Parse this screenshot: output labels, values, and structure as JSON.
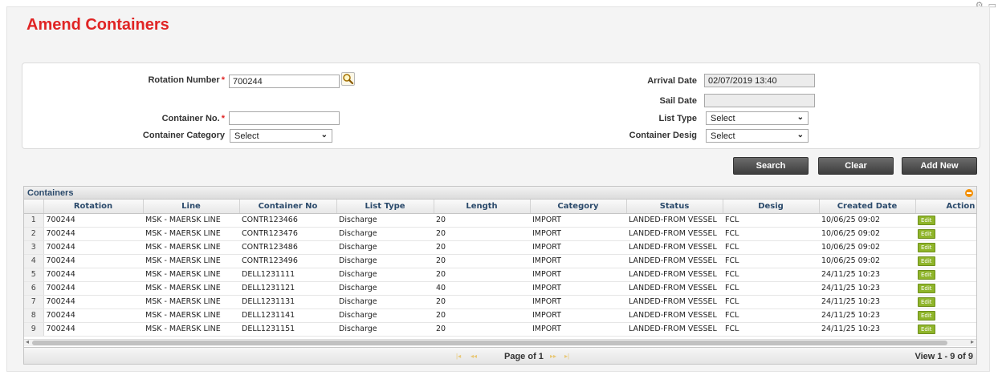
{
  "page": {
    "title": "Amend Containers"
  },
  "form": {
    "rotation_number": {
      "label": "Rotation Number",
      "required": "*",
      "value": "700244"
    },
    "container_no": {
      "label": "Container No.",
      "required": "*",
      "value": ""
    },
    "container_category": {
      "label": "Container Category",
      "value": "Select"
    },
    "arrival_date": {
      "label": "Arrival Date",
      "value": "02/07/2019 13:40"
    },
    "sail_date": {
      "label": "Sail Date",
      "value": ""
    },
    "list_type": {
      "label": "List Type",
      "value": "Select"
    },
    "container_desig": {
      "label": "Container Desig",
      "value": "Select"
    }
  },
  "buttons": {
    "search": "Search",
    "clear": "Clear",
    "add_new": "Add New"
  },
  "grid": {
    "caption": "Containers",
    "columns": [
      "Rotation",
      "Line",
      "Container No",
      "List Type",
      "Length",
      "Category",
      "Status",
      "Desig",
      "Created Date",
      "Action"
    ],
    "edit_label": "Edit",
    "rows": [
      {
        "n": "1",
        "rotation": "700244",
        "line": "MSK - MAERSK LINE",
        "container_no": "CONTR123466",
        "list_type": "Discharge",
        "length": "20",
        "category": "IMPORT",
        "status": "LANDED-FROM VESSEL",
        "desig": "FCL",
        "created": "10/06/25 09:02"
      },
      {
        "n": "2",
        "rotation": "700244",
        "line": "MSK - MAERSK LINE",
        "container_no": "CONTR123476",
        "list_type": "Discharge",
        "length": "20",
        "category": "IMPORT",
        "status": "LANDED-FROM VESSEL",
        "desig": "FCL",
        "created": "10/06/25 09:02"
      },
      {
        "n": "3",
        "rotation": "700244",
        "line": "MSK - MAERSK LINE",
        "container_no": "CONTR123486",
        "list_type": "Discharge",
        "length": "20",
        "category": "IMPORT",
        "status": "LANDED-FROM VESSEL",
        "desig": "FCL",
        "created": "10/06/25 09:02"
      },
      {
        "n": "4",
        "rotation": "700244",
        "line": "MSK - MAERSK LINE",
        "container_no": "CONTR123496",
        "list_type": "Discharge",
        "length": "20",
        "category": "IMPORT",
        "status": "LANDED-FROM VESSEL",
        "desig": "FCL",
        "created": "10/06/25 09:02"
      },
      {
        "n": "5",
        "rotation": "700244",
        "line": "MSK - MAERSK LINE",
        "container_no": "DELL1231111",
        "list_type": "Discharge",
        "length": "20",
        "category": "IMPORT",
        "status": "LANDED-FROM VESSEL",
        "desig": "FCL",
        "created": "24/11/25 10:23"
      },
      {
        "n": "6",
        "rotation": "700244",
        "line": "MSK - MAERSK LINE",
        "container_no": "DELL1231121",
        "list_type": "Discharge",
        "length": "40",
        "category": "IMPORT",
        "status": "LANDED-FROM VESSEL",
        "desig": "FCL",
        "created": "24/11/25 10:23"
      },
      {
        "n": "7",
        "rotation": "700244",
        "line": "MSK - MAERSK LINE",
        "container_no": "DELL1231131",
        "list_type": "Discharge",
        "length": "20",
        "category": "IMPORT",
        "status": "LANDED-FROM VESSEL",
        "desig": "FCL",
        "created": "24/11/25 10:23"
      },
      {
        "n": "8",
        "rotation": "700244",
        "line": "MSK - MAERSK LINE",
        "container_no": "DELL1231141",
        "list_type": "Discharge",
        "length": "20",
        "category": "IMPORT",
        "status": "LANDED-FROM VESSEL",
        "desig": "FCL",
        "created": "24/11/25 10:23"
      },
      {
        "n": "9",
        "rotation": "700244",
        "line": "MSK - MAERSK LINE",
        "container_no": "DELL1231151",
        "list_type": "Discharge",
        "length": "20",
        "category": "IMPORT",
        "status": "LANDED-FROM VESSEL",
        "desig": "FCL",
        "created": "24/11/25 10:23"
      }
    ],
    "pager": {
      "page_text": "Page of 1",
      "view_text": "View 1 - 9 of 9"
    }
  },
  "icons": {
    "lookup": "magnifier-icon",
    "collapse": "collapse-icon",
    "chevron": "chevron-down-icon",
    "top_right": [
      "settings-icon",
      "window-icon"
    ]
  }
}
